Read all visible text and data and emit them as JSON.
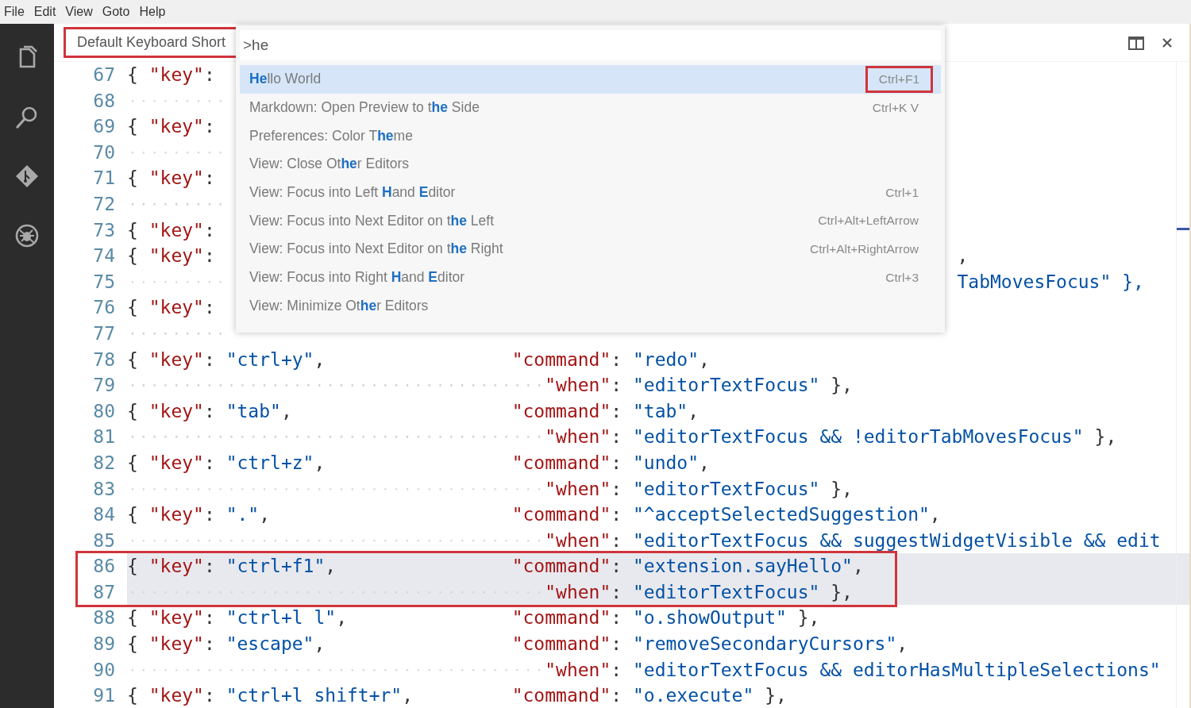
{
  "menu_bar": {
    "items": [
      "File",
      "Edit",
      "View",
      "Goto",
      "Help"
    ]
  },
  "activity_bar": {
    "items": [
      {
        "kind": "files",
        "selected": false
      },
      {
        "kind": "search",
        "selected": false
      },
      {
        "kind": "git",
        "selected": false
      },
      {
        "kind": "debug",
        "selected": false
      }
    ]
  },
  "editor": {
    "tab": {
      "title": "Default Keyboard Short",
      "annotated": true
    },
    "lines": [
      {
        "number": "67",
        "key": "{ \"key\":",
        "annotated": false,
        "highlighted": false
      },
      {
        "number": "68",
        "annotated": false,
        "highlighted": false
      },
      {
        "number": "69",
        "key": "{ \"key\":",
        "annotated": false,
        "highlighted": false
      },
      {
        "number": "70",
        "annotated": false,
        "highlighted": false
      },
      {
        "number": "71",
        "key": "{ \"key\":",
        "annotated": false,
        "highlighted": false
      },
      {
        "number": "72",
        "annotated": false,
        "highlighted": false
      },
      {
        "number": "73",
        "key": "{ \"key\":",
        "annotated": false,
        "highlighted": false
      },
      {
        "number": "74",
        "key": "{ \"key\":",
        "tail": ",",
        "annotated": false,
        "highlighted": false
      },
      {
        "number": "75",
        "tail": "TabMovesFocus\" },",
        "annotated": false,
        "highlighted": false
      },
      {
        "number": "76",
        "key": "{ \"key\":",
        "annotated": false,
        "highlighted": false
      },
      {
        "number": "77",
        "annotated": false,
        "highlighted": false
      },
      {
        "number": "78",
        "key": "{ \"key\": \"ctrl+y\",",
        "command": "\"command\": \"redo\",",
        "annotated": false,
        "highlighted": false
      },
      {
        "number": "79",
        "when": "\"when\": \"editorTextFocus\" },",
        "annotated": false,
        "highlighted": false
      },
      {
        "number": "80",
        "key": "{ \"key\": \"tab\",",
        "command": "\"command\": \"tab\",",
        "annotated": false,
        "highlighted": false
      },
      {
        "number": "81",
        "when": "\"when\": \"editorTextFocus && !editorTabMovesFocus\" },",
        "annotated": false,
        "highlighted": false
      },
      {
        "number": "82",
        "key": "{ \"key\": \"ctrl+z\",",
        "command": "\"command\": \"undo\",",
        "annotated": false,
        "highlighted": false
      },
      {
        "number": "83",
        "when": "\"when\": \"editorTextFocus\" },",
        "annotated": false,
        "highlighted": false
      },
      {
        "number": "84",
        "key": "{ \"key\": \".\",",
        "command": "\"command\": \"^acceptSelectedSuggestion\",",
        "annotated": false,
        "highlighted": false
      },
      {
        "number": "85",
        "when": "\"when\": \"editorTextFocus && suggestWidgetVisible && edit",
        "annotated": false,
        "highlighted": false
      },
      {
        "number": "86",
        "key": "{ \"key\": \"ctrl+f1\",",
        "command": "\"command\": \"extension.sayHello\",",
        "annotated": true,
        "highlighted": true
      },
      {
        "number": "87",
        "when": "\"when\": \"editorTextFocus\" },",
        "annotated": true,
        "highlighted": true
      },
      {
        "number": "88",
        "key": "{ \"key\": \"ctrl+l l\",",
        "command": "\"command\": \"o.showOutput\" },",
        "annotated": false,
        "highlighted": false
      },
      {
        "number": "89",
        "key": "{ \"key\": \"escape\",",
        "command": "\"command\": \"removeSecondaryCursors\",",
        "annotated": false,
        "highlighted": false
      },
      {
        "number": "90",
        "when": "\"when\": \"editorTextFocus && editorHasMultipleSelections\"",
        "annotated": false,
        "highlighted": false
      },
      {
        "number": "91",
        "key": "{ \"key\": \"ctrl+l shift+r\",",
        "command": "\"command\": \"o.execute\" },",
        "annotated": false,
        "highlighted": false
      }
    ]
  },
  "command_palette": {
    "value": ">he",
    "items": [
      {
        "label": "**He**llo World",
        "shortcut": "Ctrl+F1",
        "selected": true,
        "annotated": true
      },
      {
        "label": "Markdown: Open Preview to t**he** Side",
        "shortcut": "Ctrl+K V",
        "selected": false,
        "annotated": false
      },
      {
        "label": "Preferences: Color T**he**me",
        "selected": false
      },
      {
        "label": "View: Close Ot**he**r Editors",
        "selected": false
      },
      {
        "label": "View: Focus into Left **H**and **E**ditor",
        "shortcut": "Ctrl+1",
        "selected": false,
        "annotated": false
      },
      {
        "label": "View: Focus into Next Editor on t**he** Left",
        "shortcut": "Ctrl+Alt+LeftArrow",
        "selected": false,
        "annotated": false
      },
      {
        "label": "View: Focus into Next Editor on t**he** Right",
        "shortcut": "Ctrl+Alt+RightArrow",
        "selected": false,
        "annotated": false
      },
      {
        "label": "View: Focus into Right **H**and **E**ditor",
        "shortcut": "Ctrl+3",
        "selected": false,
        "annotated": false
      },
      {
        "label": "View: Minimize Ot**he**r Editors",
        "selected": false
      }
    ]
  }
}
